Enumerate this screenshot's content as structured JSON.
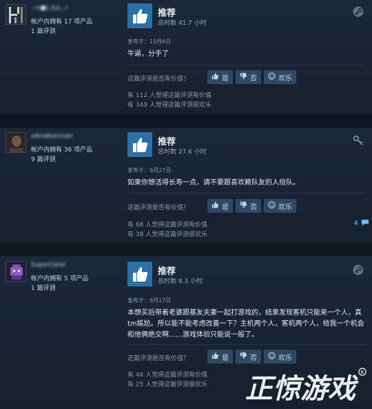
{
  "reviews": [
    {
      "username": "~n■L.tuL..r",
      "products": "帐户内拥有 17 项产品",
      "review_count": "1 篇评测",
      "recommend": "推荐",
      "hours": "总时数 41.7 小时",
      "posted": "发布于：10月6日",
      "text": "牛逼，分手了",
      "helpful_q": "这篇评测是否有价值？",
      "yes": "是",
      "no": "否",
      "funny": "欢乐",
      "stat_helpful": "有 112 人觉得这篇评测有价值",
      "stat_funny": "有 349 人觉得这篇评测很欢乐",
      "corner_icon": "steam-icon"
    },
    {
      "username": "aiknakanman",
      "products": "帐户内拥有 36 项产品",
      "review_count": "9 篇评测",
      "recommend": "推荐",
      "hours": "总时数 27.6 小时",
      "posted": "发布于：9月27日",
      "text": "如果你想活得长寿一点，请不要跟喜欢赖队友的人组队。",
      "helpful_q": "这篇评测是否有价值？",
      "yes": "是",
      "no": "否",
      "funny": "欢乐",
      "stat_helpful": "有 68 人觉得这篇评测有价值",
      "stat_funny": "有 38 人觉得这篇评测很欢乐",
      "comments": "4",
      "corner_icon": "key-icon"
    },
    {
      "username": "SuperCatal",
      "products": "帐户内拥有 5 项产品",
      "review_count": "1 篇评测",
      "recommend": "推荐",
      "hours": "总时数 8.3 小时",
      "posted": "发布于：9月17日",
      "text": "本想买后带着老婆跟基友夫妻一起打游戏的，结果发现客机只能来一个人，真tm尴尬。所以能不能考虑改善一下？主机两个人，客机两个人，给我一个机会和他俩绝交啊……游戏体验只能说一般了。",
      "helpful_q": "这篇评测是否有价值？",
      "yes": "是",
      "no": "否",
      "funny": "欢乐",
      "stat_helpful": "有 46 人觉得这篇评测有价值",
      "stat_funny": "有 25 人觉得这篇评测很欢乐",
      "corner_icon": "steam-icon"
    }
  ],
  "watermark_text": "正惊游戏"
}
